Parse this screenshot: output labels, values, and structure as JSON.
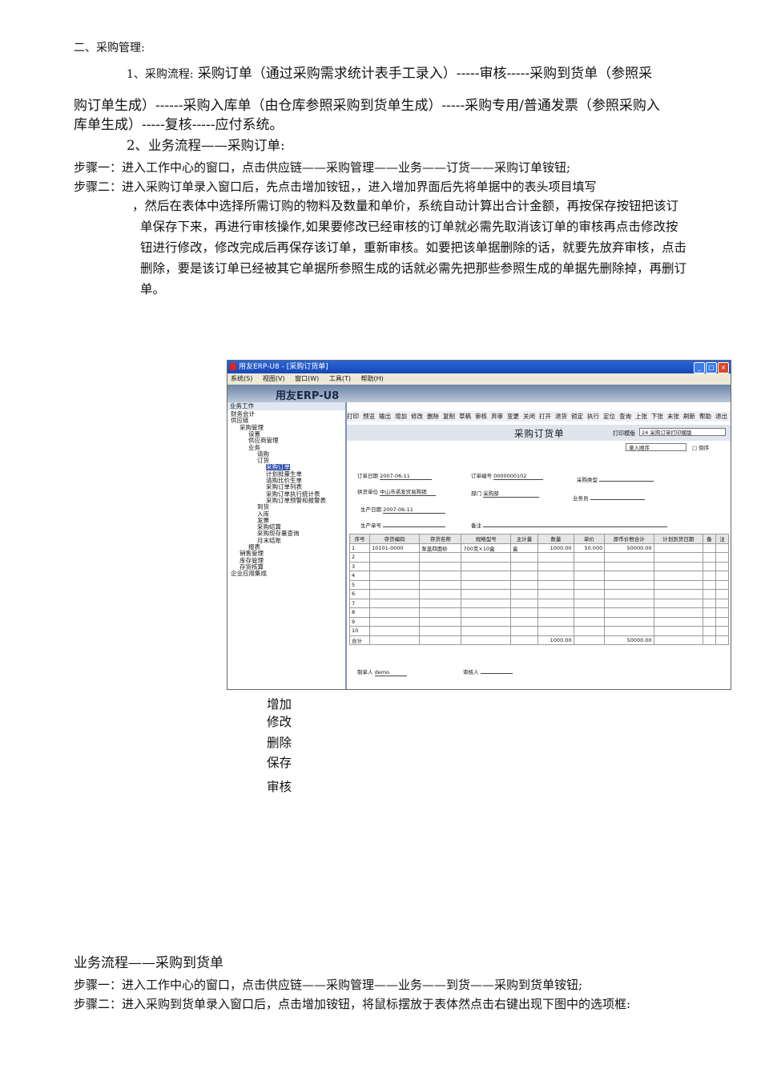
{
  "heading": "二、采购管理:",
  "section1": {
    "label": "1、采购流程:",
    "text_line1": "采购订单（通过采购需求统计表手工录入）-----审核-----采购到货单（参照采",
    "text_line2": "购订单生成）------采购入库单（由仓库参照采购到货单生成）-----采购专用/普通发票（参照采购入",
    "text_line3": "库单生成）-----复核-----应付系统。"
  },
  "section2": {
    "title": "2、业务流程——采购订单:",
    "step1": "步骤一：进入工作中心的窗口，点击供应链——采购管理——业务——订货——采购订单铵钮;",
    "step2_line": "步骤二：进入采购订单录入窗口后，先点击增加铵钮，，进入增加界面后先将单据中的表头项目填写",
    "para_line1": "，然后在表体中选择所需订购的物料及数量和单价，系统自动计算出合计金额，再按保存按钮把该订",
    "para_line2": "单保存下来，再进行审核操作,如果要修改已经审核的订单就必需先取消该订单的审核再点击修改按",
    "para_line3": "钮进行修改，修改完成后再保存该订单，重新审核。如要把该单据删除的话，就要先放弃审核，点击",
    "para_line4": "删除，要是该订单已经被其它单据所参照生成的话就必需先把那些参照生成的单据先删除掉，再删订",
    "para_line5": "单。"
  },
  "screenshot": {
    "window_title": "用友ERP-U8 - [采购订货单]",
    "menu": [
      "系统(S)",
      "视图(V)",
      "窗口(W)",
      "工具(T)",
      "帮助(H)"
    ],
    "logo": "用友ERP-U8",
    "tree_header": "业务工作",
    "tree": [
      {
        "label": "财务会计",
        "indent": 0
      },
      {
        "label": "供应链",
        "indent": 0
      },
      {
        "label": "采购管理",
        "indent": 1
      },
      {
        "label": "设置",
        "indent": 2
      },
      {
        "label": "供应商管理",
        "indent": 2
      },
      {
        "label": "业务",
        "indent": 2
      },
      {
        "label": "请购",
        "indent": 3
      },
      {
        "label": "订货",
        "indent": 3
      },
      {
        "label": "采购订单",
        "indent": 4,
        "selected": true
      },
      {
        "label": "计划批量生单",
        "indent": 4
      },
      {
        "label": "请购比价生单",
        "indent": 4
      },
      {
        "label": "采购订单列表",
        "indent": 4
      },
      {
        "label": "采购订单执行统计表",
        "indent": 4
      },
      {
        "label": "采购订单预警和报警表",
        "indent": 4
      },
      {
        "label": "到货",
        "indent": 3
      },
      {
        "label": "入库",
        "indent": 3
      },
      {
        "label": "发票",
        "indent": 3
      },
      {
        "label": "采购结算",
        "indent": 3
      },
      {
        "label": "采购现存量查询",
        "indent": 3
      },
      {
        "label": "月末结账",
        "indent": 3
      },
      {
        "label": "报表",
        "indent": 2
      },
      {
        "label": "销售管理",
        "indent": 1
      },
      {
        "label": "库存管理",
        "indent": 1
      },
      {
        "label": "存货核算",
        "indent": 1
      },
      {
        "label": "企业应用集成",
        "indent": 0
      }
    ],
    "toolbar": [
      "打印",
      "预览",
      "输出",
      "增加",
      "修改",
      "删除",
      "复制",
      "草稿",
      "审核",
      "弃审",
      "变更",
      "关闭",
      "打开",
      "退货",
      "锁定",
      "执行",
      "定位",
      "查询",
      "上张",
      "下张",
      "末张",
      "刷新",
      "帮助",
      "退出"
    ],
    "form_title": "采购订货单",
    "print_template_label": "打印模版",
    "print_template_value": "24 采购订单打印模版",
    "sort_value": "录入顺序",
    "sort_reverse": "倒序",
    "fields": {
      "order_date_label": "订单日期",
      "order_date": "2007-06-11",
      "order_no_label": "订单编号",
      "order_no": "0000000102",
      "purchase_type_label": "采购类型",
      "supplier_label": "供货单位",
      "supplier": "中山市诺发贸易购销",
      "dept_label": "部门",
      "dept": "采购部",
      "salesman_label": "业务员",
      "prod_date_label": "生产日期",
      "prod_date": "2007-06-11",
      "prod_no_label": "生产单号",
      "remark_label": "备注"
    },
    "table": {
      "headers": [
        "序号",
        "存货编码",
        "存货名称",
        "规格型号",
        "主计量",
        "数量",
        "单价",
        "原币价税合计",
        "计划到货日期",
        "备",
        "注"
      ],
      "rows": [
        [
          "1",
          "10101-0000",
          "泵盖四面砂",
          "700克×10盒",
          "盒",
          "1000.00",
          "50.000",
          "50000.00",
          "",
          "",
          ""
        ],
        [
          "2",
          "",
          "",
          "",
          "",
          "",
          "",
          "",
          "",
          "",
          ""
        ],
        [
          "3",
          "",
          "",
          "",
          "",
          "",
          "",
          "",
          "",
          "",
          ""
        ],
        [
          "4",
          "",
          "",
          "",
          "",
          "",
          "",
          "",
          "",
          "",
          ""
        ],
        [
          "5",
          "",
          "",
          "",
          "",
          "",
          "",
          "",
          "",
          "",
          ""
        ],
        [
          "6",
          "",
          "",
          "",
          "",
          "",
          "",
          "",
          "",
          "",
          ""
        ],
        [
          "7",
          "",
          "",
          "",
          "",
          "",
          "",
          "",
          "",
          "",
          ""
        ],
        [
          "8",
          "",
          "",
          "",
          "",
          "",
          "",
          "",
          "",
          "",
          ""
        ],
        [
          "9",
          "",
          "",
          "",
          "",
          "",
          "",
          "",
          "",
          "",
          ""
        ],
        [
          "10",
          "",
          "",
          "",
          "",
          "",
          "",
          "",
          "",
          "",
          ""
        ]
      ],
      "total": [
        "合计",
        "",
        "",
        "",
        "",
        "1000.00",
        "",
        "50000.00",
        "",
        "",
        ""
      ]
    },
    "maker_label": "制单人",
    "maker": "demo",
    "auditor_label": "审核人"
  },
  "button_notes": [
    "增加",
    "修改",
    "删除",
    "保存",
    "审核"
  ],
  "section3": {
    "title": "业务流程——采购到货单",
    "step1": "步骤一：进入工作中心的窗口，点击供应链——采购管理——业务——到货——采购到货单铵钮;",
    "step2": "步骤二：进入采购到货单录入窗口后，点击增加铵钮，将鼠标摆放于表体然点击右键出现下图中的选项框:"
  }
}
